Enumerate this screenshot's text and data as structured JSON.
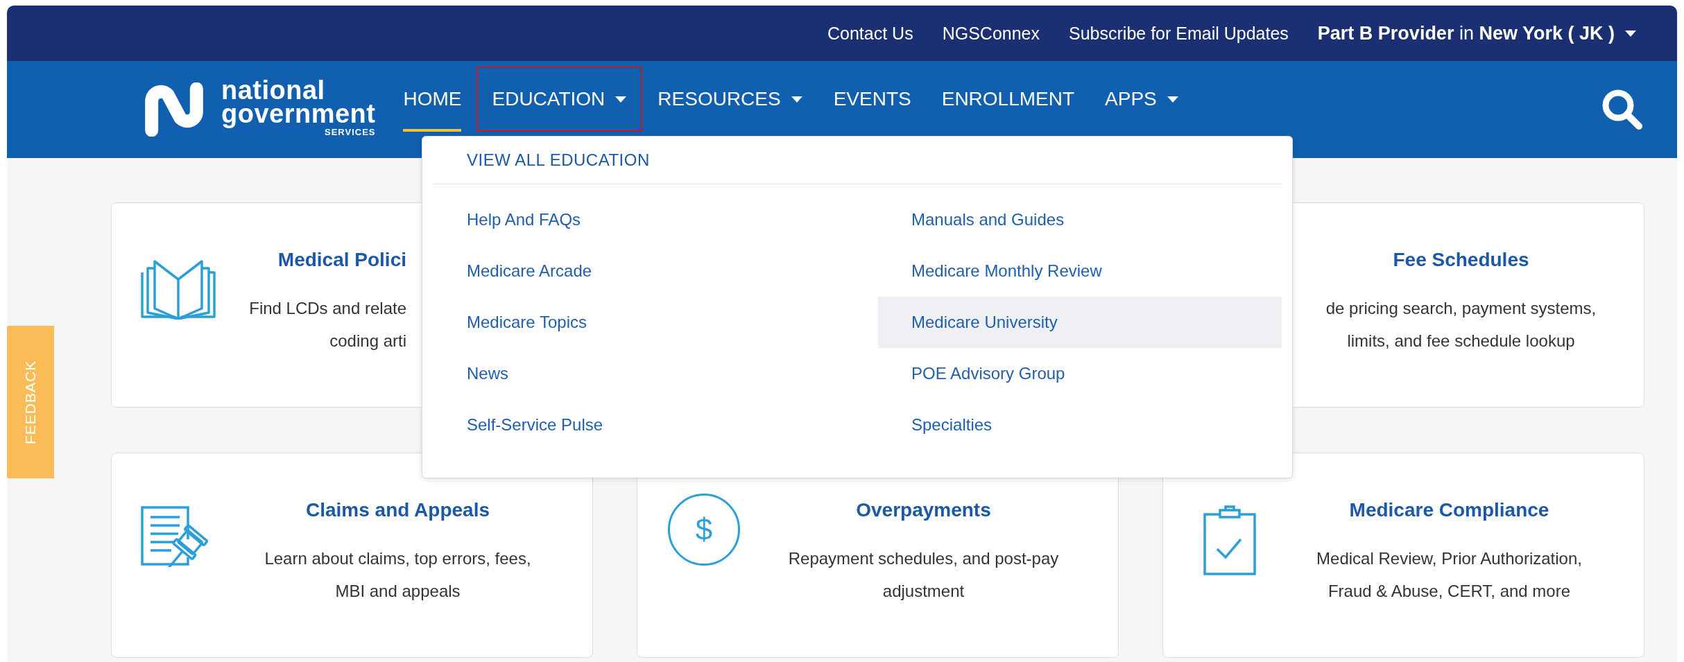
{
  "top_bar": {
    "links": [
      "Contact Us",
      "NGSConnex",
      "Subscribe for Email Updates"
    ],
    "region_selector": {
      "label": "**Part B Provider** in **New York ( JK )**"
    }
  },
  "logo": {
    "name_lines": [
      "national",
      "government"
    ],
    "tagline": "SERVICES"
  },
  "nav": {
    "items": [
      {
        "label": "HOME",
        "has_menu": false,
        "selected": true,
        "expanded": false
      },
      {
        "label": "EDUCATION",
        "has_menu": true,
        "selected": false,
        "expanded": true
      },
      {
        "label": "RESOURCES",
        "has_menu": true,
        "selected": false,
        "expanded": false
      },
      {
        "label": "EVENTS",
        "has_menu": false,
        "selected": false,
        "expanded": false
      },
      {
        "label": "ENROLLMENT",
        "has_menu": false,
        "selected": false,
        "expanded": false
      },
      {
        "label": "APPS",
        "has_menu": true,
        "selected": false,
        "expanded": false
      }
    ]
  },
  "dropdown": {
    "header": "VIEW ALL EDUCATION",
    "columns": [
      [
        {
          "label": "Help And FAQs",
          "selected": false
        },
        {
          "label": "Medicare Arcade",
          "selected": false
        },
        {
          "label": "Medicare Topics",
          "selected": false
        },
        {
          "label": "News",
          "selected": false
        },
        {
          "label": "Self-Service Pulse",
          "selected": false
        }
      ],
      [
        {
          "label": "Manuals and Guides",
          "selected": false
        },
        {
          "label": "Medicare Monthly Review",
          "selected": false
        },
        {
          "label": "Medicare University",
          "selected": true
        },
        {
          "label": "POE Advisory Group",
          "selected": false
        },
        {
          "label": "Specialties",
          "selected": false
        }
      ]
    ]
  },
  "cards": [
    {
      "kind": "clipped_right",
      "title": "Medical Polici",
      "lines": [
        "Find LCDs and relate",
        "coding arti"
      ]
    },
    {
      "kind": "clipped_left",
      "title": "Fee Schedules",
      "lines": [
        "de pricing search, payment systems,",
        "limits, and fee schedule lookup"
      ]
    },
    {
      "kind": "full",
      "title": "Claims and Appeals",
      "lines": [
        "Learn about claims, top errors, fees,",
        "MBI and appeals"
      ]
    },
    {
      "kind": "full",
      "title": "Overpayments",
      "icon_glyph": "$",
      "lines": [
        "Repayment schedules, and post-pay",
        "adjustment"
      ]
    },
    {
      "kind": "full",
      "title": "Medicare Compliance",
      "lines": [
        "Medical Review, Prior Authorization,",
        "Fraud & Abuse, CERT, and more"
      ]
    }
  ],
  "feedback": {
    "label": "FEEDBACK"
  }
}
